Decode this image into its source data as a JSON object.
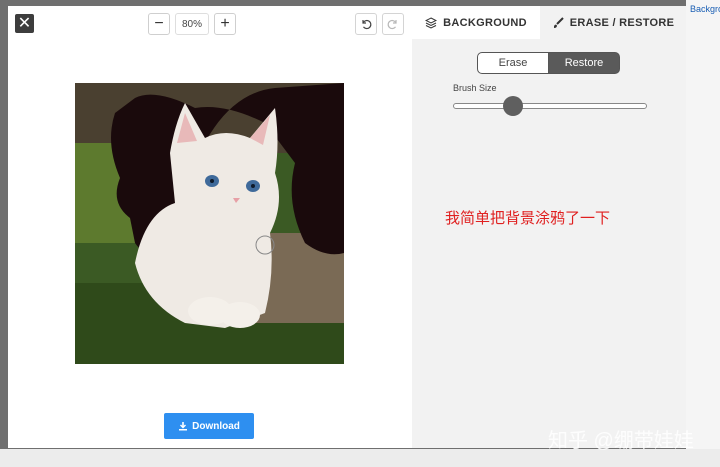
{
  "toolbar": {
    "close_glyph": "✕",
    "zoom_out": "−",
    "zoom_level": "80%",
    "zoom_in": "+"
  },
  "panel": {
    "tabs": [
      {
        "label": "BACKGROUND",
        "icon": "layers-icon"
      },
      {
        "label": "ERASE / RESTORE",
        "icon": "brush-icon"
      }
    ],
    "mode_options": [
      "Erase",
      "Restore"
    ],
    "active_mode": "Restore",
    "brush_label": "Brush Size",
    "brush_size_level": 0.31
  },
  "annotation_text": "我简单把背景涂鸦了一下",
  "download_label": "Download",
  "watermark_text": "知乎 @绷带娃娃",
  "colors": {
    "accent_blue": "#2e8ff0",
    "annotation_red": "#e02020",
    "panel_bg": "#f2f2f2",
    "active_mode_bg": "#5a5a5a"
  }
}
